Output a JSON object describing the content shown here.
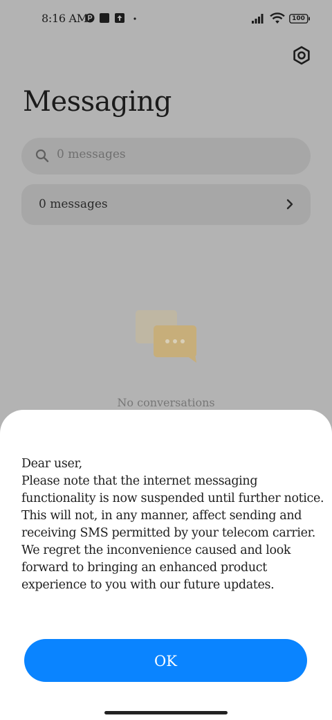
{
  "status_bar": {
    "time": "8:16 AM",
    "battery": "100"
  },
  "header": {
    "title": "Messaging",
    "settings_icon": "gear-hex-icon"
  },
  "search": {
    "placeholder": "0 messages"
  },
  "filter": {
    "label": "0 messages"
  },
  "empty_state": {
    "text": "No conversations"
  },
  "dialog": {
    "greeting": "Dear user,",
    "message": "Please note that the internet messaging functionality is now suspended until further notice. This will not, in any manner, affect sending and receiving SMS permitted by your telecom carrier. We regret the inconvenience caused and look forward to bringing an enhanced product experience to you with our future updates.",
    "ok_label": "OK"
  },
  "colors": {
    "overlay_background": "#b3b3b3",
    "accent": "#0a84ff",
    "sheet": "#ffffff"
  }
}
